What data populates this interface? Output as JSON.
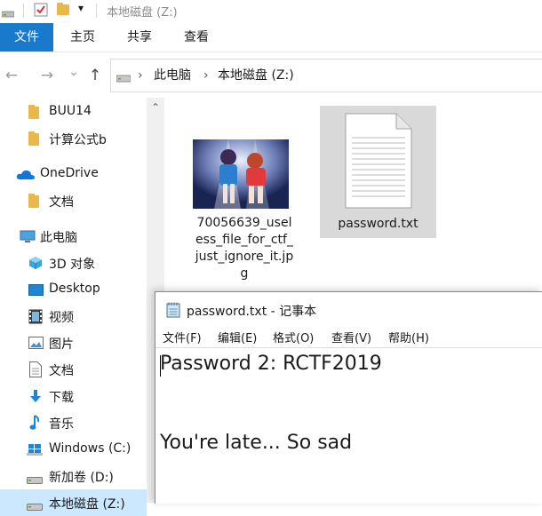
{
  "titlebar": {
    "location": "本地磁盘 (Z:)",
    "qa_dropdown": "▾"
  },
  "ribbon": {
    "tabs": [
      "文件",
      "主页",
      "共享",
      "查看"
    ]
  },
  "nav": {
    "back": "←",
    "forward": "→",
    "history": "⌄",
    "up": "↑"
  },
  "address": {
    "crumbs": [
      "此电脑",
      "本地磁盘 (Z:)"
    ],
    "sep": "›"
  },
  "sidebar": {
    "scroll_up": "⌃",
    "items": [
      {
        "label": "BUU14",
        "icon": "folder-icon"
      },
      {
        "label": "计算公式b",
        "icon": "folder-icon"
      },
      {
        "label": "OneDrive",
        "icon": "cloud-icon"
      },
      {
        "label": "文档",
        "icon": "folder-icon"
      },
      {
        "label": "此电脑",
        "icon": "computer-icon"
      },
      {
        "label": "3D 对象",
        "icon": "cube-icon"
      },
      {
        "label": "Desktop",
        "icon": "desktop-icon"
      },
      {
        "label": "视频",
        "icon": "film-icon"
      },
      {
        "label": "图片",
        "icon": "picture-icon"
      },
      {
        "label": "文档",
        "icon": "document-icon"
      },
      {
        "label": "下载",
        "icon": "download-icon"
      },
      {
        "label": "音乐",
        "icon": "music-icon"
      },
      {
        "label": "Windows (C:)",
        "icon": "drive-icon"
      },
      {
        "label": "新加卷 (D:)",
        "icon": "drive-icon"
      },
      {
        "label": "本地磁盘 (Z:)",
        "icon": "drive-icon"
      }
    ]
  },
  "files": [
    {
      "name_lines": [
        "70056639_usel",
        "ess_file_for_ctf_",
        "just_ignore_it.jp",
        "g"
      ],
      "type": "image"
    },
    {
      "name_lines": [
        "password.txt"
      ],
      "type": "text",
      "selected": true
    }
  ],
  "notepad": {
    "title": "password.txt - 记事本",
    "menu": [
      "文件(F)",
      "编辑(E)",
      "格式(O)",
      "查看(V)",
      "帮助(H)"
    ],
    "lines": [
      "Password 2: RCTF2019",
      "You're late... So sad"
    ]
  },
  "colors": {
    "accent": "#1979ca",
    "selection": "#cce8ff",
    "file_selected": "#d9d9d9"
  }
}
